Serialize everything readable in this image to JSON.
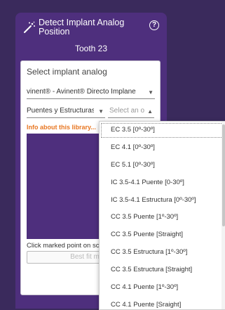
{
  "header": {
    "title": "Detect Implant Analog Position",
    "help_icon": "?",
    "subtitle": "Tooth 23"
  },
  "card": {
    "label": "Select implant analog",
    "library_select": "vinent® - Avinent® Directo Implane",
    "category_select": "Puentes y Estructuras",
    "option_select_placeholder": "Select an option",
    "info_link": "Info about this library...",
    "hint": "Click marked point on scan",
    "fit_button": "Best fit match"
  },
  "dropdown": {
    "options": [
      "EC 3.5 [0º-30º]",
      "EC 4.1 [0º-30º]",
      "EC 5.1 [0º-30º]",
      "IC 3.5-4.1 Puente [0-30º]",
      "IC 3.5-4.1 Estructura [0º-30º]",
      "CC 3.5 Puente [1º-30º]",
      "CC 3.5 Puente [Straight]",
      "CC 3.5 Estructura [1º-30º]",
      "CC 3.5 Estructura [Straight]",
      "CC 4.1 Puente [1º-30º]",
      "CC 4.1 Puente [Sraight]"
    ]
  },
  "colors": {
    "background": "#3a2a5c",
    "panel": "#4e2f7d",
    "info_accent": "#e87722"
  }
}
